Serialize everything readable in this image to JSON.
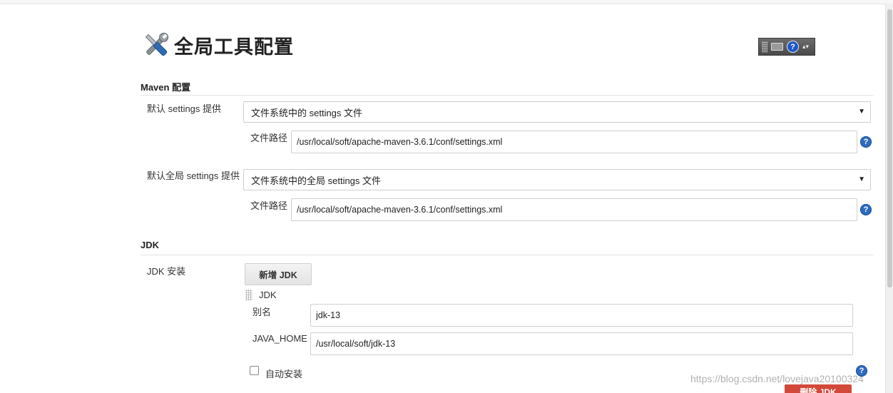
{
  "header": {
    "title": "全局工具配置",
    "title_icon": "tools-icon"
  },
  "toolbar_widget": {
    "icons": [
      "grip-icon",
      "keyboard-icon",
      "help-icon",
      "more-icon"
    ],
    "help_glyph": "?",
    "more_glyph": "▴▾"
  },
  "maven": {
    "section_title": "Maven 配置",
    "settings": {
      "label": "默认 settings 提供",
      "selected": "文件系统中的 settings 文件",
      "path_label": "文件路径",
      "path_value": "/usr/local/soft/apache-maven-3.6.1/conf/settings.xml"
    },
    "global_settings": {
      "label": "默认全局 settings 提供",
      "selected": "文件系统中的全局 settings 文件",
      "path_label": "文件路径",
      "path_value": "/usr/local/soft/apache-maven-3.6.1/conf/settings.xml"
    }
  },
  "jdk": {
    "section_title": "JDK",
    "install_label": "JDK 安装",
    "add_button": "新增 JDK",
    "item_title": "JDK",
    "alias_label": "别名",
    "alias_value": "jdk-13",
    "java_home_label": "JAVA_HOME",
    "java_home_value": "/usr/local/soft/jdk-13",
    "auto_install_label": "自动安装",
    "auto_install_checked": false,
    "delete_button": "删除 JDK"
  },
  "help_glyph": "?",
  "dropdown_glyph": "▼",
  "watermark": "https://blog.csdn.net/lovejava20100324",
  "colors": {
    "help_blue": "#2d6cc0",
    "delete_red": "#d24939"
  }
}
